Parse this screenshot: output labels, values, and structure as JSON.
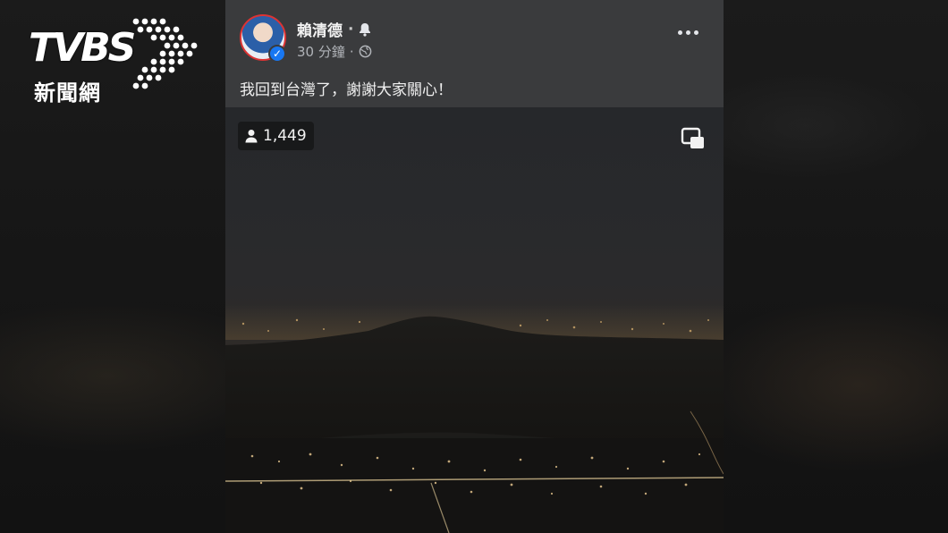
{
  "watermark": {
    "brand": "TVBS",
    "subtitle": "新聞網"
  },
  "post": {
    "author": "賴清德",
    "separator": "·",
    "time": "30 分鐘",
    "time_separator": "·",
    "privacy_icon": "globe-icon",
    "notify_icon": "bell-icon",
    "more_icon": "more-options-icon",
    "text": "我回到台灣了，謝謝大家關心！"
  },
  "video": {
    "viewer_count": "1,449",
    "viewer_icon": "person-icon",
    "pip_icon": "picture-in-picture-icon"
  },
  "colors": {
    "header_bg": "#3a3b3d",
    "verified": "#1877f2",
    "text": "#f0f0f0"
  }
}
